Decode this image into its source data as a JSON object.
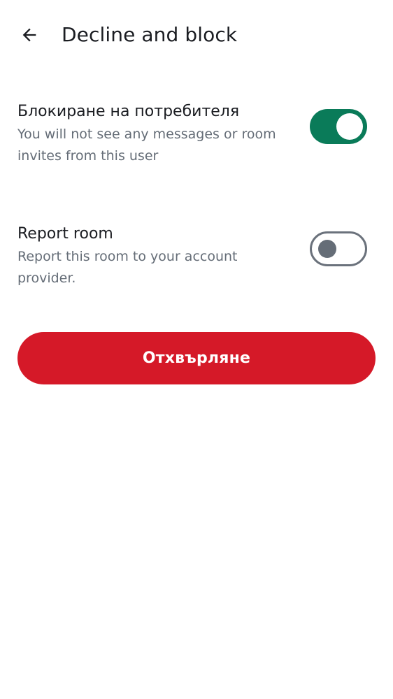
{
  "header": {
    "back_icon": "arrow-left-icon",
    "title": "Decline and block"
  },
  "settings": {
    "block_user": {
      "title": "Блокиране на потребителя",
      "description": "You will not see any messages or room invites from this user",
      "enabled": true
    },
    "report_room": {
      "title": "Report room",
      "description": "Report this room to your account provider.",
      "enabled": false
    }
  },
  "actions": {
    "decline_label": "Отхвърляне"
  },
  "colors": {
    "accent_on": "#0a7b59",
    "destructive": "#d51928",
    "secondary_text": "#656d77"
  }
}
